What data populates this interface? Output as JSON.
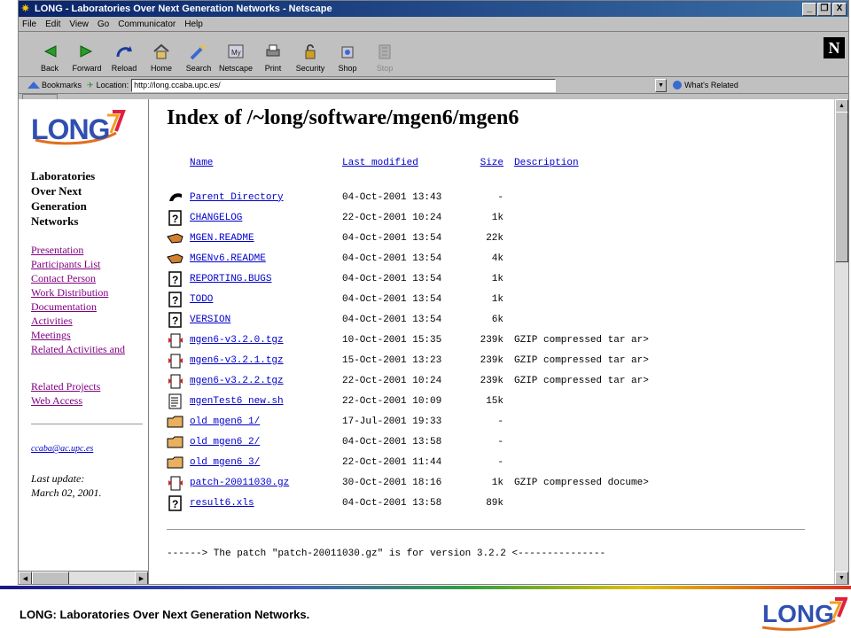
{
  "window": {
    "title": "LONG - Laboratories Over Next Generation Networks - Netscape",
    "controls": [
      "_",
      "❐",
      "X"
    ]
  },
  "menu": [
    "File",
    "Edit",
    "View",
    "Go",
    "Communicator",
    "Help"
  ],
  "toolbar": {
    "buttons": [
      {
        "label": "Back",
        "icon": "back-arrow-icon"
      },
      {
        "label": "Forward",
        "icon": "forward-arrow-icon"
      },
      {
        "label": "Reload",
        "icon": "reload-icon"
      },
      {
        "label": "Home",
        "icon": "home-icon"
      },
      {
        "label": "Search",
        "icon": "search-icon"
      },
      {
        "label": "Netscape",
        "icon": "netscape-icon"
      },
      {
        "label": "Print",
        "icon": "print-icon"
      },
      {
        "label": "Security",
        "icon": "lock-icon"
      },
      {
        "label": "Shop",
        "icon": "shop-icon"
      },
      {
        "label": "Stop",
        "icon": "stop-icon"
      }
    ],
    "brand": "N"
  },
  "location": {
    "bookmarks_label": "Bookmarks",
    "location_label": "Location:",
    "url": "http://long.ccaba.upc.es/",
    "whats_related": "What's Related"
  },
  "sidebar": {
    "logo_text": "LONG",
    "lab_title": [
      "Laboratories",
      "Over Next",
      "Generation",
      "Networks"
    ],
    "links_group1": [
      "Presentation",
      "Participants List",
      "Contact Person",
      "Work Distribution",
      "Documentation",
      "Activities",
      "Meetings",
      "Related Activities and"
    ],
    "links_group2": [
      "Related Projects",
      "Web Access"
    ],
    "email": "ccaba@ac.upc.es",
    "last_update_label": "Last update:",
    "last_update_date": "March 02, 2001."
  },
  "main": {
    "title": "Index of /~long/software/mgen6/mgen6",
    "columns": {
      "name": "Name",
      "modified": "Last modified",
      "size": "Size",
      "description": "Description"
    },
    "files": [
      {
        "icon": "back-icon",
        "name": "Parent Directory",
        "modified": "04-Oct-2001 13:43",
        "size": "-",
        "description": ""
      },
      {
        "icon": "unknown-file-icon",
        "name": "CHANGELOG",
        "modified": "22-Oct-2001 10:24",
        "size": "1k",
        "description": ""
      },
      {
        "icon": "readme-hand-icon",
        "name": "MGEN.README",
        "modified": "04-Oct-2001 13:54",
        "size": "22k",
        "description": ""
      },
      {
        "icon": "readme-hand-icon",
        "name": "MGENv6.README",
        "modified": "04-Oct-2001 13:54",
        "size": "4k",
        "description": ""
      },
      {
        "icon": "unknown-file-icon",
        "name": "REPORTING.BUGS",
        "modified": "04-Oct-2001 13:54",
        "size": "1k",
        "description": ""
      },
      {
        "icon": "unknown-file-icon",
        "name": "TODO",
        "modified": "04-Oct-2001 13:54",
        "size": "1k",
        "description": ""
      },
      {
        "icon": "unknown-file-icon",
        "name": "VERSION",
        "modified": "04-Oct-2001 13:54",
        "size": "6k",
        "description": ""
      },
      {
        "icon": "compressed-file-icon",
        "name": "mgen6-v3.2.0.tgz",
        "modified": "10-Oct-2001 15:35",
        "size": "239k",
        "description": "GZIP compressed tar ar>"
      },
      {
        "icon": "compressed-file-icon",
        "name": "mgen6-v3.2.1.tgz",
        "modified": "15-Oct-2001 13:23",
        "size": "239k",
        "description": "GZIP compressed tar ar>"
      },
      {
        "icon": "compressed-file-icon",
        "name": "mgen6-v3.2.2.tgz",
        "modified": "22-Oct-2001 10:24",
        "size": "239k",
        "description": "GZIP compressed tar ar>"
      },
      {
        "icon": "script-file-icon",
        "name": "mgenTest6 new.sh",
        "modified": "22-Oct-2001 10:09",
        "size": "15k",
        "description": ""
      },
      {
        "icon": "folder-icon",
        "name": "old mgen6 1/",
        "modified": "17-Jul-2001 19:33",
        "size": "-",
        "description": ""
      },
      {
        "icon": "folder-icon",
        "name": "old mgen6 2/",
        "modified": "04-Oct-2001 13:58",
        "size": "-",
        "description": ""
      },
      {
        "icon": "folder-icon",
        "name": "old mgen6 3/",
        "modified": "22-Oct-2001 11:44",
        "size": "-",
        "description": ""
      },
      {
        "icon": "compressed-file-icon",
        "name": "patch-20011030.gz",
        "modified": "30-Oct-2001 18:16",
        "size": "1k",
        "description": "GZIP compressed docume>"
      },
      {
        "icon": "unknown-file-icon",
        "name": "result6.xls",
        "modified": "04-Oct-2001 13:58",
        "size": "89k",
        "description": ""
      }
    ],
    "note": "------> The patch \"patch-20011030.gz\" is for version 3.2.2 <---------------"
  },
  "footer": {
    "text": "LONG: Laboratories Over Next Generation Networks.",
    "logo_text": "LONG"
  }
}
